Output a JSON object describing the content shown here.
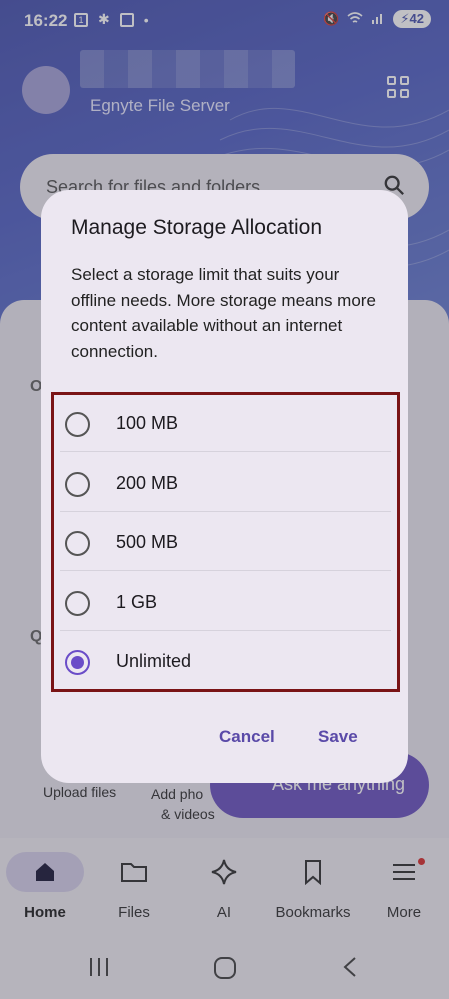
{
  "status_bar": {
    "time": "16:22",
    "battery": "42"
  },
  "header": {
    "server_name": "Egnyte File Server"
  },
  "search": {
    "placeholder": "Search for files and folders"
  },
  "background": {
    "section_letter_1": "O",
    "section_letter_2": "Q",
    "upload_label": "Upload files",
    "add_photos_label_1": "Add pho",
    "add_photos_label_2": "& videos",
    "ask_label": "Ask me anything"
  },
  "dialog": {
    "title": "Manage Storage Allocation",
    "description": "Select a storage limit that suits your offline needs. More storage means more content available without an internet connection.",
    "options": [
      {
        "label": "100 MB",
        "selected": false
      },
      {
        "label": "200 MB",
        "selected": false
      },
      {
        "label": "500 MB",
        "selected": false
      },
      {
        "label": "1 GB",
        "selected": false
      },
      {
        "label": "Unlimited",
        "selected": true
      }
    ],
    "cancel_label": "Cancel",
    "save_label": "Save"
  },
  "bottom_nav": {
    "items": [
      {
        "label": "Home",
        "icon": "home-icon",
        "active": true
      },
      {
        "label": "Files",
        "icon": "folder-icon",
        "active": false
      },
      {
        "label": "AI",
        "icon": "sparkle-icon",
        "active": false
      },
      {
        "label": "Bookmarks",
        "icon": "bookmark-icon",
        "active": false
      },
      {
        "label": "More",
        "icon": "menu-icon",
        "active": false
      }
    ]
  },
  "colors": {
    "accent": "#6a4cc8",
    "highlight_border": "#7a1416",
    "header_bg": "#4a55b0"
  }
}
